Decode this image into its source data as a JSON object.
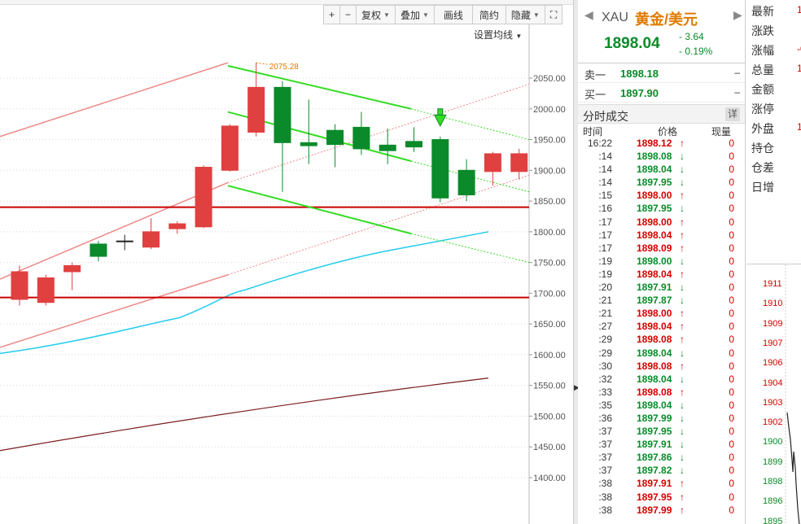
{
  "toolbar": {
    "zoom_in": "+",
    "zoom_out": "−",
    "restore": "复权",
    "overlay": "叠加",
    "draw": "画线",
    "simple": "简约",
    "hide": "隐藏",
    "fullscreen": "⛶"
  },
  "ma_setting": "设置均线",
  "chart_data": {
    "type": "candlestick",
    "y_ticks": [
      "2050.00",
      "2000.00",
      "1950.00",
      "1900.00",
      "1850.00",
      "1800.00",
      "1750.00",
      "1700.00",
      "1650.00",
      "1600.00",
      "1550.00",
      "1500.00",
      "1450.00",
      "1400.00"
    ],
    "ylim": [
      1390,
      2080
    ],
    "annotation": "2075.28",
    "horizontal_levels": [
      1840,
      1693
    ],
    "candles": [
      {
        "o": 1690,
        "c": 1735,
        "h": 1745,
        "l": 1680
      },
      {
        "o": 1685,
        "c": 1725,
        "h": 1730,
        "l": 1680
      },
      {
        "o": 1735,
        "c": 1745,
        "h": 1750,
        "l": 1705
      },
      {
        "o": 1780,
        "c": 1760,
        "h": 1785,
        "l": 1752
      },
      {
        "o": 1785,
        "c": 1785,
        "h": 1795,
        "l": 1770
      },
      {
        "o": 1775,
        "c": 1800,
        "h": 1822,
        "l": 1772
      },
      {
        "o": 1805,
        "c": 1813,
        "h": 1817,
        "l": 1797
      },
      {
        "o": 1808,
        "c": 1905,
        "h": 1908,
        "l": 1806
      },
      {
        "o": 1900,
        "c": 1972,
        "h": 1975,
        "l": 1898
      },
      {
        "o": 1962,
        "c": 2035,
        "h": 2075,
        "l": 1955
      },
      {
        "o": 2035,
        "c": 1945,
        "h": 2045,
        "l": 1865
      },
      {
        "o": 1945,
        "c": 1940,
        "h": 2015,
        "l": 1910
      },
      {
        "o": 1965,
        "c": 1942,
        "h": 1975,
        "l": 1905
      },
      {
        "o": 1970,
        "c": 1935,
        "h": 1995,
        "l": 1925
      },
      {
        "o": 1941,
        "c": 1932,
        "h": 1968,
        "l": 1910
      },
      {
        "o": 1947,
        "c": 1938,
        "h": 1970,
        "l": 1930
      },
      {
        "o": 1950,
        "c": 1855,
        "h": 1955,
        "l": 1848
      },
      {
        "o": 1900,
        "c": 1860,
        "h": 1918,
        "l": 1850
      },
      {
        "o": 1898,
        "c": 1927,
        "h": 1930,
        "l": 1875
      },
      {
        "o": 1898,
        "c": 1927,
        "h": 1935,
        "l": 1885
      }
    ]
  },
  "quote": {
    "code": "XAU",
    "name": "黄金/美元",
    "last": "1898.04",
    "change": "- 3.64",
    "change_pct": "- 0.19%",
    "sell_label": "卖一",
    "sell_price": "1898.18",
    "buy_label": "买一",
    "buy_price": "1897.90",
    "dash": "–",
    "ticks_title": "分时成交",
    "detail": "详",
    "col_time": "时间",
    "col_price": "价格",
    "col_vol": "现量",
    "ticks": [
      {
        "t": "16:22",
        "p": "1898.12",
        "d": "up",
        "v": "0"
      },
      {
        "t": ":14",
        "p": "1898.08",
        "d": "dn",
        "v": "0"
      },
      {
        "t": ":14",
        "p": "1898.04",
        "d": "dn",
        "v": "0"
      },
      {
        "t": ":14",
        "p": "1897.95",
        "d": "dn",
        "v": "0"
      },
      {
        "t": ":15",
        "p": "1898.00",
        "d": "up",
        "v": "0"
      },
      {
        "t": ":16",
        "p": "1897.95",
        "d": "dn",
        "v": "0"
      },
      {
        "t": ":17",
        "p": "1898.00",
        "d": "up",
        "v": "0"
      },
      {
        "t": ":17",
        "p": "1898.04",
        "d": "up",
        "v": "0"
      },
      {
        "t": ":17",
        "p": "1898.09",
        "d": "up",
        "v": "0"
      },
      {
        "t": ":19",
        "p": "1898.00",
        "d": "dn",
        "v": "0"
      },
      {
        "t": ":19",
        "p": "1898.04",
        "d": "up",
        "v": "0"
      },
      {
        "t": ":20",
        "p": "1897.91",
        "d": "dn",
        "v": "0"
      },
      {
        "t": ":21",
        "p": "1897.87",
        "d": "dn",
        "v": "0"
      },
      {
        "t": ":21",
        "p": "1898.00",
        "d": "up",
        "v": "0"
      },
      {
        "t": ":27",
        "p": "1898.04",
        "d": "up",
        "v": "0"
      },
      {
        "t": ":29",
        "p": "1898.08",
        "d": "up",
        "v": "0"
      },
      {
        "t": ":29",
        "p": "1898.04",
        "d": "dn",
        "v": "0"
      },
      {
        "t": ":30",
        "p": "1898.08",
        "d": "up",
        "v": "0"
      },
      {
        "t": ":32",
        "p": "1898.04",
        "d": "dn",
        "v": "0"
      },
      {
        "t": ":33",
        "p": "1898.08",
        "d": "up",
        "v": "0"
      },
      {
        "t": ":35",
        "p": "1898.04",
        "d": "dn",
        "v": "0"
      },
      {
        "t": ":36",
        "p": "1897.99",
        "d": "dn",
        "v": "0"
      },
      {
        "t": ":37",
        "p": "1897.95",
        "d": "dn",
        "v": "0"
      },
      {
        "t": ":37",
        "p": "1897.91",
        "d": "dn",
        "v": "0"
      },
      {
        "t": ":37",
        "p": "1897.86",
        "d": "dn",
        "v": "0"
      },
      {
        "t": ":37",
        "p": "1897.82",
        "d": "dn",
        "v": "0"
      },
      {
        "t": ":38",
        "p": "1897.91",
        "d": "up",
        "v": "0"
      },
      {
        "t": ":38",
        "p": "1897.95",
        "d": "up",
        "v": "0"
      },
      {
        "t": ":38",
        "p": "1897.99",
        "d": "up",
        "v": "0"
      }
    ]
  },
  "stats": {
    "rows": [
      {
        "label": "最新",
        "value": "18"
      },
      {
        "label": "涨跌",
        "value": ""
      },
      {
        "label": "涨幅",
        "value": "-0"
      },
      {
        "label": "总量",
        "value": "1"
      },
      {
        "label": "金额",
        "value": ""
      },
      {
        "label": "涨停",
        "value": ""
      },
      {
        "label": "外盘",
        "value": "1"
      },
      {
        "label": "持仓",
        "value": ""
      },
      {
        "label": "仓差",
        "value": ""
      },
      {
        "label": "日增",
        "value": ""
      }
    ],
    "mini_labels": [
      "1911",
      "1910",
      "1909",
      "1907",
      "1906",
      "1904",
      "1903",
      "1902",
      "1900",
      "1899",
      "1898",
      "1896",
      "1895"
    ]
  },
  "colors": {
    "up": "#e04040",
    "down": "#0a8a2a",
    "ma_fast": "#22ccee",
    "ma_slow": "#7a1a1a",
    "channel_red": "#ee8888",
    "channel_green": "#33dd22",
    "level": "#cc0000"
  }
}
